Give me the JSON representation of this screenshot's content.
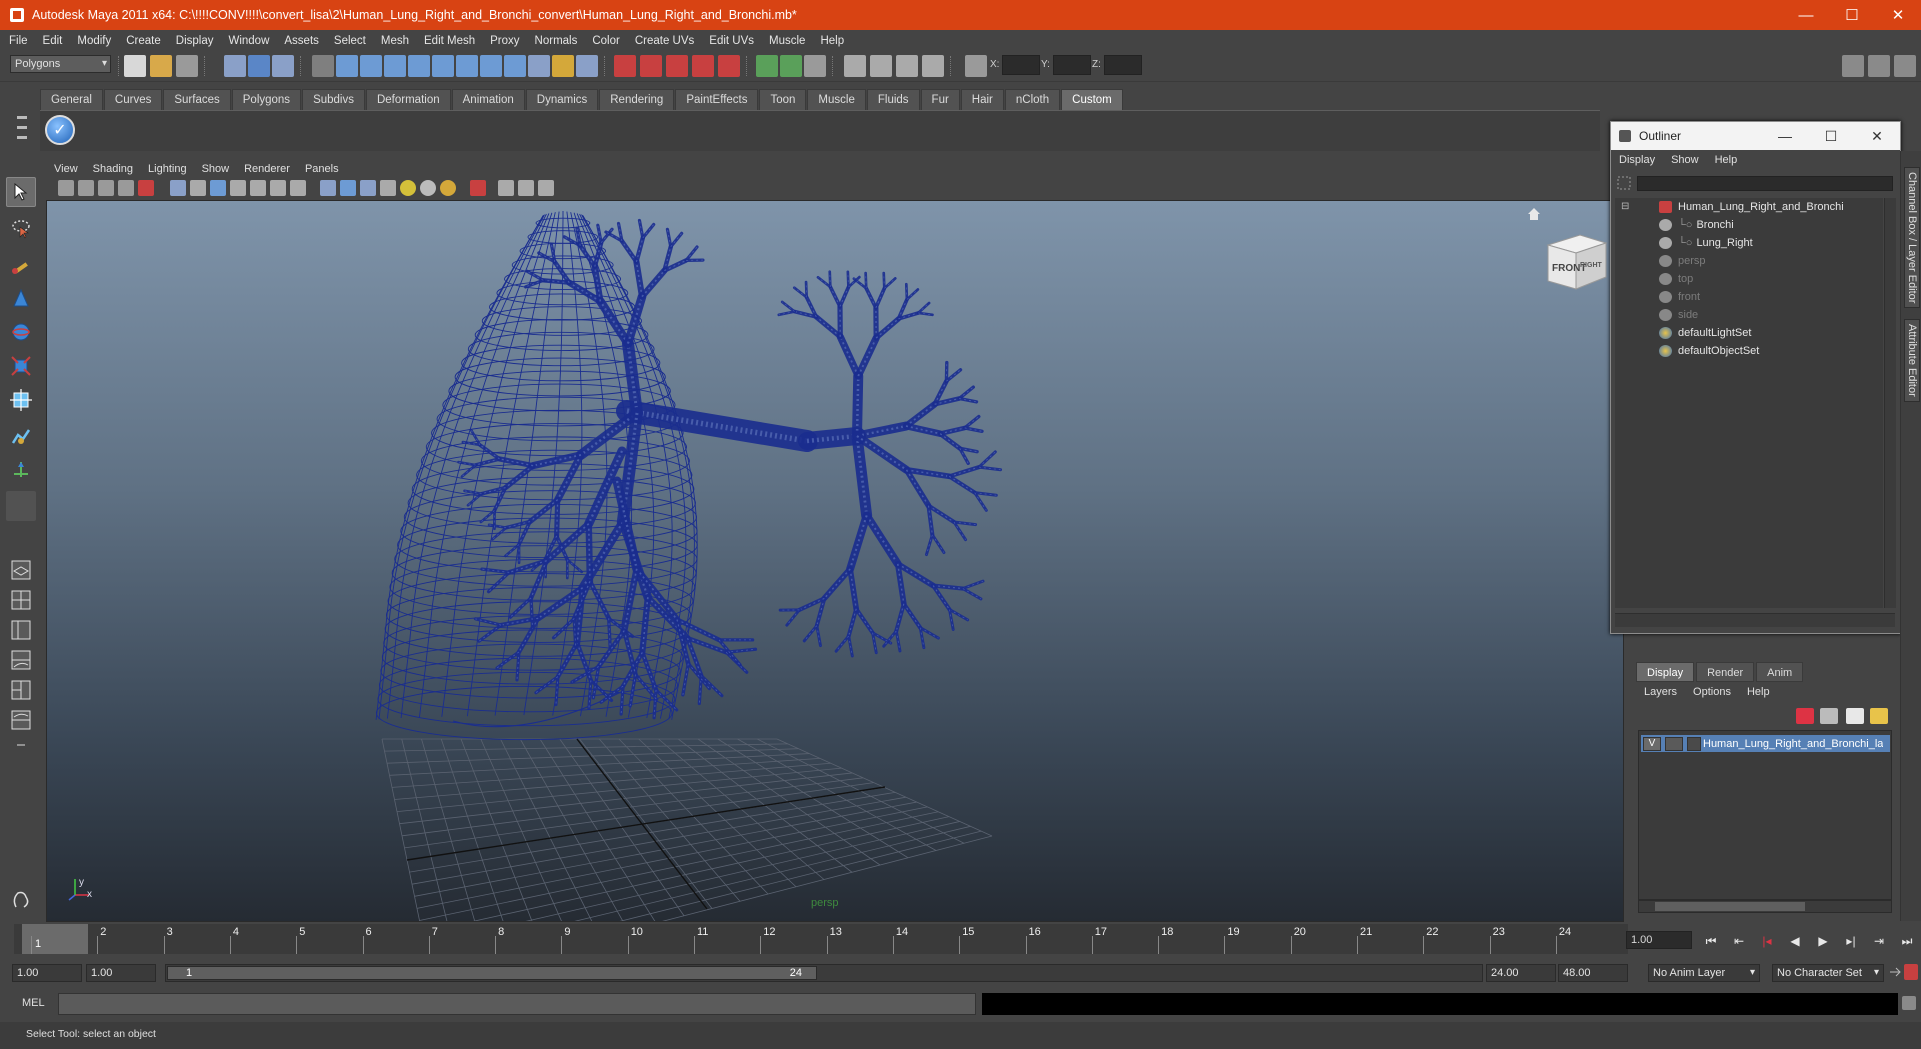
{
  "window": {
    "title": "Autodesk Maya 2011 x64: C:\\!!!!CONV!!!!\\convert_lisa\\2\\Human_Lung_Right_and_Bronchi_convert\\Human_Lung_Right_and_Bronchi.mb*",
    "minimize": "—",
    "maximize": "☐",
    "close": "✕"
  },
  "menubar": [
    "File",
    "Edit",
    "Modify",
    "Create",
    "Display",
    "Window",
    "Assets",
    "Select",
    "Mesh",
    "Edit Mesh",
    "Proxy",
    "Normals",
    "Color",
    "Create UVs",
    "Edit UVs",
    "Muscle",
    "Help"
  ],
  "statusline": {
    "mode": "Polygons",
    "x_label": "X:",
    "y_label": "Y:",
    "z_label": "Z:"
  },
  "shelf": {
    "tabs": [
      "General",
      "Curves",
      "Surfaces",
      "Polygons",
      "Subdivs",
      "Deformation",
      "Animation",
      "Dynamics",
      "Rendering",
      "PaintEffects",
      "Toon",
      "Muscle",
      "Fluids",
      "Fur",
      "Hair",
      "nCloth",
      "Custom"
    ],
    "active_tab": "Custom"
  },
  "viewport": {
    "menu": [
      "View",
      "Shading",
      "Lighting",
      "Show",
      "Renderer",
      "Panels"
    ],
    "viewcube": {
      "front": "FRONT",
      "right": "RIGHT"
    },
    "camera_label": "persp",
    "axis": {
      "x": "x",
      "y": "y"
    },
    "wire_color": "#1a2d8f"
  },
  "outliner": {
    "title": "Outliner",
    "menu": [
      "Display",
      "Show",
      "Help"
    ],
    "items": [
      {
        "label": "Human_Lung_Right_and_Bronchi",
        "icon": "transform-group-icon",
        "dim": false
      },
      {
        "label": "Bronchi",
        "icon": "mesh-icon",
        "dim": false
      },
      {
        "label": "Lung_Right",
        "icon": "mesh-icon",
        "dim": false
      },
      {
        "label": "persp",
        "icon": "camera-icon",
        "dim": true
      },
      {
        "label": "top",
        "icon": "camera-icon",
        "dim": true
      },
      {
        "label": "front",
        "icon": "camera-icon",
        "dim": true
      },
      {
        "label": "side",
        "icon": "camera-icon",
        "dim": true
      },
      {
        "label": "defaultLightSet",
        "icon": "set-icon",
        "dim": false
      },
      {
        "label": "defaultObjectSet",
        "icon": "set-icon",
        "dim": false
      }
    ]
  },
  "sidetabs": {
    "channel_box": "Channel Box / Layer Editor",
    "attribute_editor": "Attribute Editor"
  },
  "layer_editor": {
    "tabs": [
      "Display",
      "Render",
      "Anim"
    ],
    "active_tab": "Display",
    "menu": [
      "Layers",
      "Options",
      "Help"
    ],
    "layer": {
      "visible": "V",
      "name": "Human_Lung_Right_and_Bronchi_layer"
    }
  },
  "timeline": {
    "ticks": [
      "1",
      "2",
      "3",
      "4",
      "5",
      "6",
      "7",
      "8",
      "9",
      "10",
      "11",
      "12",
      "13",
      "14",
      "15",
      "16",
      "17",
      "18",
      "19",
      "20",
      "21",
      "22",
      "23",
      "24"
    ],
    "current_frame": "1",
    "current_time": "1.00"
  },
  "range": {
    "start": "1.00",
    "range_start": "1.00",
    "handle_start": "1",
    "handle_end": "24",
    "range_end": "24.00",
    "end": "48.00",
    "anim_layer": "No Anim Layer",
    "character_set": "No Character Set"
  },
  "commandline": {
    "label": "MEL"
  },
  "helpline": {
    "text": "Select Tool: select an object"
  },
  "colors": {
    "title_bar": "#d84313",
    "selection": "#5680b5"
  }
}
